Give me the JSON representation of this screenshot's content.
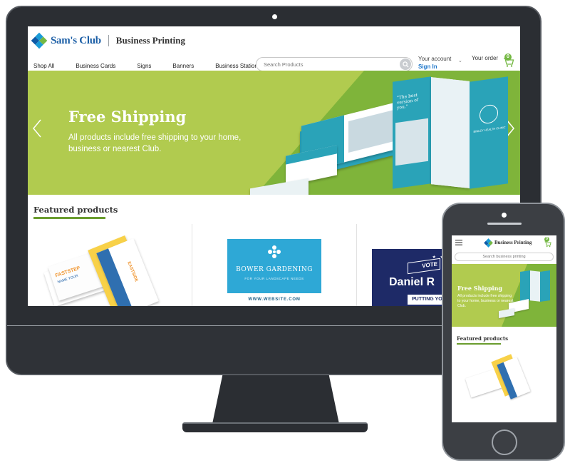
{
  "desktop": {
    "brand": "Sam's Club",
    "product_title": "Business Printing",
    "nav": [
      "Shop All",
      "Business Cards",
      "Signs",
      "Banners",
      "Business Stationery"
    ],
    "search": {
      "placeholder": "Search Products"
    },
    "account": {
      "label": "Your account",
      "signin": "Sign In"
    },
    "order": {
      "label": "Your order",
      "count": "0"
    },
    "hero": {
      "title": "Free Shipping",
      "subtitle": "All products include free shipping to your home, business or nearest Club.",
      "brochure_quote": "\"The best version of you.\"",
      "brochure_clinic": "BINLEY HEALTH CLINIC"
    },
    "featured_heading": "Featured products",
    "products": {
      "card_text_1": "FASTSTEP",
      "card_text_2": "EASTSIDE",
      "card_text_3": "NAME YOUR",
      "garden_title": "BOWER GARDENING",
      "garden_tag": "FOR YOUR LANDSCAPE NEEDS",
      "garden_url": "WWW.WEBSITE.COM",
      "sign_name": "Daniel R",
      "sign_vote": "VOTE",
      "sign_tag": "PUTTING YOU"
    }
  },
  "mobile": {
    "title": "Business Printing",
    "cart_count": "0",
    "search_placeholder": "Search business printing",
    "hero_title": "Free Shipping",
    "hero_subtitle": "All products include free shipping to your home, business or nearest Club.",
    "featured_heading": "Featured products"
  },
  "colors": {
    "hero_green": "#b1cb4f",
    "accent_green": "#74b843",
    "brand_blue": "#1b5ea6",
    "teal": "#2aa3b8",
    "device_dark": "#2b2e33"
  }
}
